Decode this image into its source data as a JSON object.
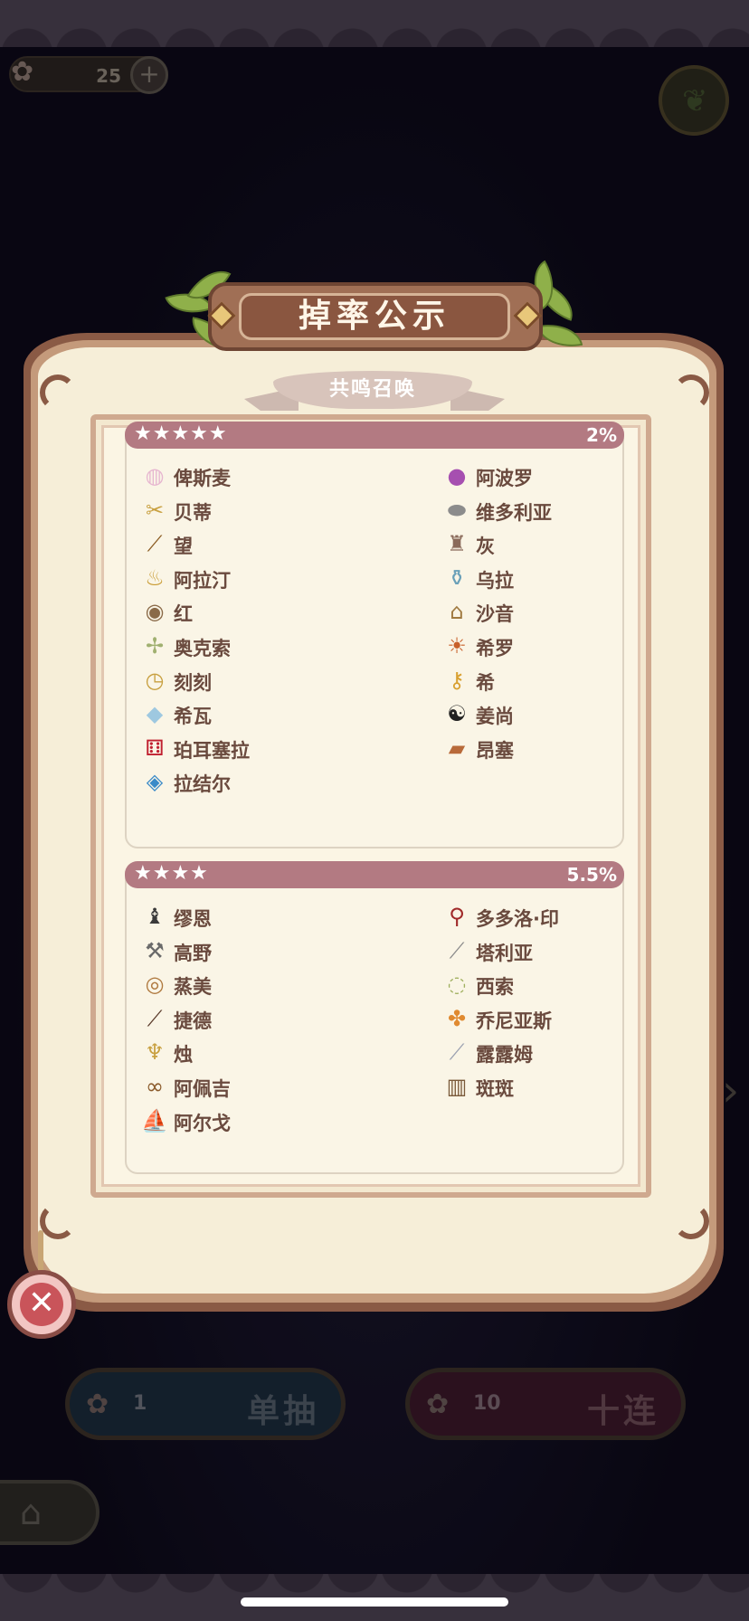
{
  "top_bar": {
    "currency_count": "25",
    "plus_label": "+"
  },
  "dialog": {
    "title": "掉率公示",
    "subtitle": "共鸣召唤",
    "tiers": [
      {
        "stars": "★★★★★",
        "rate": "2%",
        "items": [
          {
            "name": "俾斯麦",
            "icon": "pastel-stone-icon"
          },
          {
            "name": "阿波罗",
            "icon": "purple-button-icon"
          },
          {
            "name": "贝蒂",
            "icon": "scissors-icon"
          },
          {
            "name": "维多利亚",
            "icon": "silver-tray-icon"
          },
          {
            "name": "望",
            "icon": "telescope-icon"
          },
          {
            "name": "灰",
            "icon": "brush-icon"
          },
          {
            "name": "阿拉汀",
            "icon": "magic-lamp-icon"
          },
          {
            "name": "乌拉",
            "icon": "potion-bottle-icon"
          },
          {
            "name": "红",
            "icon": "basket-icon"
          },
          {
            "name": "沙音",
            "icon": "birdcage-icon"
          },
          {
            "name": "奥克索",
            "icon": "pinwheel-icon"
          },
          {
            "name": "希罗",
            "icon": "lantern-icon"
          },
          {
            "name": "刻刻",
            "icon": "pocket-watch-icon"
          },
          {
            "name": "希",
            "icon": "key-icon"
          },
          {
            "name": "希瓦",
            "icon": "crystal-icon"
          },
          {
            "name": "姜尚",
            "icon": "yin-yang-icon"
          },
          {
            "name": "珀耳塞拉",
            "icon": "dice-icon"
          },
          {
            "name": "昂塞",
            "icon": "book-icon"
          },
          {
            "name": "拉结尔",
            "icon": "mirror-icon"
          }
        ]
      },
      {
        "stars": "★★★★",
        "rate": "5.5%",
        "items": [
          {
            "name": "缪恩",
            "icon": "chess-piece-icon"
          },
          {
            "name": "多多洛·印",
            "icon": "seal-stamp-icon"
          },
          {
            "name": "高野",
            "icon": "hammer-icon"
          },
          {
            "name": "塔利亚",
            "icon": "blade-icon"
          },
          {
            "name": "蒸美",
            "icon": "steamer-icon"
          },
          {
            "name": "西索",
            "icon": "tape-icon"
          },
          {
            "name": "捷德",
            "icon": "needle-icon"
          },
          {
            "name": "乔尼亚斯",
            "icon": "fruits-icon"
          },
          {
            "name": "烛",
            "icon": "candle-icon"
          },
          {
            "name": "露露姆",
            "icon": "test-tube-icon"
          },
          {
            "name": "阿佩吉",
            "icon": "glasses-icon"
          },
          {
            "name": "斑斑",
            "icon": "drum-icon"
          },
          {
            "name": "阿尔戈",
            "icon": "ship-icon"
          }
        ]
      }
    ],
    "close_label": "✕"
  },
  "bottom": {
    "single": {
      "qty": "1",
      "label": "单抽"
    },
    "ten": {
      "qty": "10",
      "label": "十连"
    }
  }
}
